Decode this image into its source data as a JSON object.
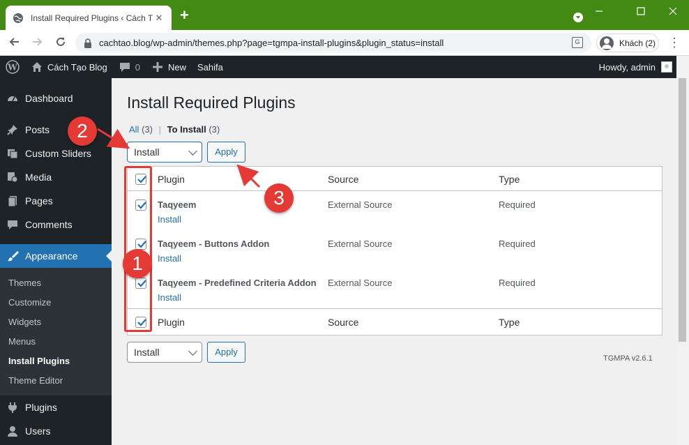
{
  "browser": {
    "tab_title": "Install Required Plugins ‹ Cách Tạ",
    "url": "cachtao.blog/wp-admin/themes.php?page=tgmpa-install-plugins&plugin_status=install",
    "profile_label": "Khách (2)"
  },
  "adminbar": {
    "site_name": "Cách Tạo Blog",
    "comments_count": "0",
    "new_label": "New",
    "theme_label": "Sahifa",
    "howdy": "Howdy, admin"
  },
  "sidebar": {
    "items": [
      {
        "label": "Dashboard",
        "icon": "dashboard-icon"
      },
      {
        "label": "Posts",
        "icon": "pin-icon"
      },
      {
        "label": "Custom Sliders",
        "icon": "slides-icon"
      },
      {
        "label": "Media",
        "icon": "media-icon"
      },
      {
        "label": "Pages",
        "icon": "page-icon"
      },
      {
        "label": "Comments",
        "icon": "comment-icon"
      },
      {
        "label": "Appearance",
        "icon": "brush-icon"
      },
      {
        "label": "Plugins",
        "icon": "plug-icon"
      },
      {
        "label": "Users",
        "icon": "user-icon"
      }
    ],
    "submenu": [
      "Themes",
      "Customize",
      "Widgets",
      "Menus",
      "Install Plugins",
      "Theme Editor"
    ]
  },
  "main": {
    "title": "Install Required Plugins",
    "views": {
      "all_label": "All",
      "all_count": "(3)",
      "to_install_label": "To Install",
      "to_install_count": "(3)"
    },
    "bulk_action_top": "Install",
    "bulk_action_bottom": "Install",
    "apply_label": "Apply",
    "columns": [
      "Plugin",
      "Source",
      "Type"
    ],
    "rows": [
      {
        "name": "Taqyeem",
        "action": "Install",
        "source": "External Source",
        "type": "Required"
      },
      {
        "name": "Taqyeem - Buttons Addon",
        "action": "Install",
        "source": "External Source",
        "type": "Required"
      },
      {
        "name": "Taqyeem - Predefined Criteria Addon",
        "action": "Install",
        "source": "External Source",
        "type": "Required"
      }
    ],
    "version": "TGMPA v2.6.1"
  },
  "annotations": {
    "badge_1": "1",
    "badge_2": "2",
    "badge_3": "3",
    "color": "#e53935"
  },
  "colors": {
    "browser_frame": "#438a14",
    "wp_dark": "#1d2327",
    "wp_blue": "#2271b1"
  }
}
